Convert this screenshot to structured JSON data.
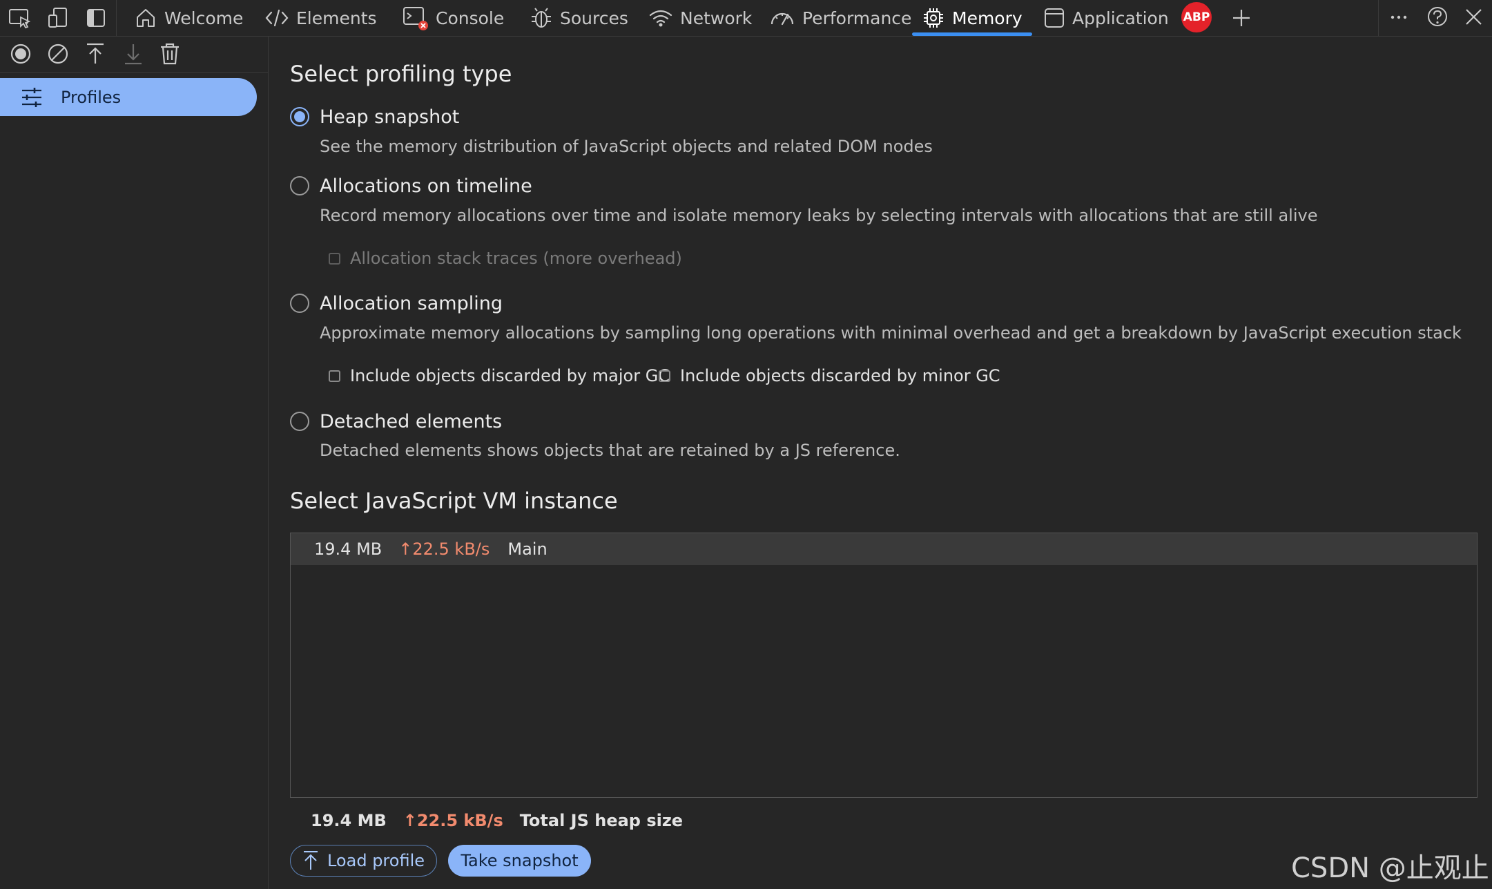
{
  "tabs": [
    {
      "label": "Welcome",
      "icon": "home-icon"
    },
    {
      "label": "Elements",
      "icon": "code-icon"
    },
    {
      "label": "Console",
      "icon": "console-icon"
    },
    {
      "label": "Sources",
      "icon": "bug-icon"
    },
    {
      "label": "Network",
      "icon": "wifi-icon"
    },
    {
      "label": "Performance",
      "icon": "gauge-icon"
    },
    {
      "label": "Memory",
      "icon": "chip-icon",
      "active": true
    },
    {
      "label": "Application",
      "icon": "app-window-icon"
    }
  ],
  "abp_label": "ABP",
  "sidebar": {
    "profiles_label": "Profiles"
  },
  "profiling": {
    "heading": "Select profiling type",
    "options": [
      {
        "label": "Heap snapshot",
        "desc": "See the memory distribution of JavaScript objects and related DOM nodes",
        "checked": true
      },
      {
        "label": "Allocations on timeline",
        "desc": "Record memory allocations over time and isolate memory leaks by selecting intervals with allocations that are still alive"
      },
      {
        "label": "Allocation sampling",
        "desc": "Approximate memory allocations by sampling long operations with minimal overhead and get a breakdown by JavaScript execution stack"
      },
      {
        "label": "Detached elements",
        "desc": "Detached elements shows objects that are retained by a JS reference."
      }
    ],
    "stack_traces_label": "Allocation stack traces (more overhead)",
    "major_gc_label": "Include objects discarded by major GC",
    "minor_gc_label": "Include objects discarded by minor GC"
  },
  "vm": {
    "heading": "Select JavaScript VM instance",
    "instance": {
      "size": "19.4 MB",
      "rate": "↑22.5 kB/s",
      "name": "Main"
    }
  },
  "summary": {
    "size": "19.4 MB",
    "rate": "↑22.5 kB/s",
    "label": "Total JS heap size"
  },
  "buttons": {
    "load": "Load profile",
    "snapshot": "Take snapshot"
  },
  "watermark": "CSDN @止观止",
  "colors": {
    "accent": "#8ab4f8",
    "tab_underline": "#3b8ff2",
    "rate": "#f28b6e",
    "abp": "#e4222a"
  }
}
